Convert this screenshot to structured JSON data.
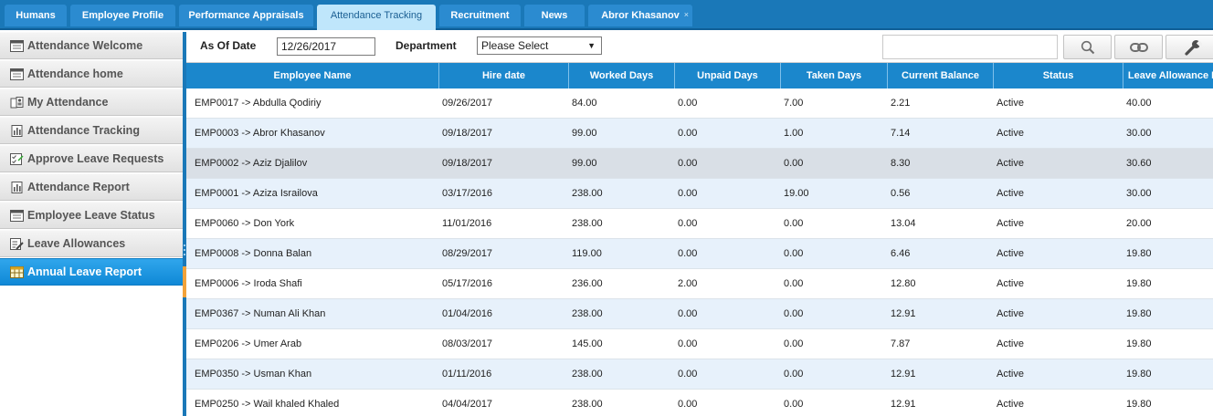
{
  "tabs": [
    {
      "label": "Humans",
      "active": false
    },
    {
      "label": "Employee Profile",
      "active": false
    },
    {
      "label": "Performance Appraisals",
      "active": false
    },
    {
      "label": "Attendance Tracking",
      "active": true
    },
    {
      "label": "Recruitment",
      "active": false
    },
    {
      "label": "News",
      "active": false
    },
    {
      "label": "Abror Khasanov",
      "active": false,
      "close_glyph": "×"
    }
  ],
  "sidebar": {
    "items": [
      {
        "label": "Attendance Welcome",
        "icon": "window-icon"
      },
      {
        "label": "Attendance home",
        "icon": "window-icon"
      },
      {
        "label": "My Attendance",
        "icon": "users-icon"
      },
      {
        "label": "Attendance Tracking",
        "icon": "report-icon"
      },
      {
        "label": "Approve Leave Requests",
        "icon": "checklist-icon"
      },
      {
        "label": "Attendance Report",
        "icon": "report-icon"
      },
      {
        "label": "Employee Leave Status",
        "icon": "window-icon"
      },
      {
        "label": "Leave Allowances",
        "icon": "edit-list-icon"
      },
      {
        "label": "Annual Leave Report",
        "icon": "calendar-grid-icon",
        "active": true
      }
    ]
  },
  "filters": {
    "as_of_date_label": "As Of Date",
    "as_of_date_value": "12/26/2017",
    "department_label": "Department",
    "department_value": "Please Select",
    "search_value": ""
  },
  "toolbar": {
    "search_icon": "magnifier-icon",
    "link_icon": "chain-link-icon",
    "settings_icon": "wrench-icon"
  },
  "grid": {
    "columns": [
      "Employee Name",
      "Hire date",
      "Worked Days",
      "Unpaid Days",
      "Taken Days",
      "Current Balance",
      "Status",
      "Leave Allowance D"
    ],
    "rows": [
      [
        "EMP0017 -> Abdulla Qodiriy",
        "09/26/2017",
        "84.00",
        "0.00",
        "7.00",
        "2.21",
        "Active",
        "40.00"
      ],
      [
        "EMP0003 -> Abror Khasanov",
        "09/18/2017",
        "99.00",
        "0.00",
        "1.00",
        "7.14",
        "Active",
        "30.00"
      ],
      [
        "EMP0002 -> Aziz Djalilov",
        "09/18/2017",
        "99.00",
        "0.00",
        "0.00",
        "8.30",
        "Active",
        "30.60"
      ],
      [
        "EMP0001 -> Aziza Israilova",
        "03/17/2016",
        "238.00",
        "0.00",
        "19.00",
        "0.56",
        "Active",
        "30.00"
      ],
      [
        "EMP0060 -> Don York",
        "11/01/2016",
        "238.00",
        "0.00",
        "0.00",
        "13.04",
        "Active",
        "20.00"
      ],
      [
        "EMP0008 -> Donna Balan",
        "08/29/2017",
        "119.00",
        "0.00",
        "0.00",
        "6.46",
        "Active",
        "19.80"
      ],
      [
        "EMP0006 -> Iroda Shafi",
        "05/17/2016",
        "236.00",
        "2.00",
        "0.00",
        "12.80",
        "Active",
        "19.80"
      ],
      [
        "EMP0367 -> Numan Ali Khan",
        "01/04/2016",
        "238.00",
        "0.00",
        "0.00",
        "12.91",
        "Active",
        "19.80"
      ],
      [
        "EMP0206 -> Umer Arab",
        "08/03/2017",
        "145.00",
        "0.00",
        "0.00",
        "7.87",
        "Active",
        "19.80"
      ],
      [
        "EMP0350 -> Usman Khan",
        "01/11/2016",
        "238.00",
        "0.00",
        "0.00",
        "12.91",
        "Active",
        "19.80"
      ],
      [
        "EMP0250 -> Wail khaled Khaled",
        "04/04/2017",
        "238.00",
        "0.00",
        "0.00",
        "12.91",
        "Active",
        "19.80"
      ]
    ],
    "highlighted_row": 2
  },
  "colors": {
    "tab_bar": "#1a78b8",
    "active_tab": "#bfe6fb",
    "grid_header": "#1b87cc",
    "row_alt": "#e7f1fb",
    "row_highlight": "#d9dfe6",
    "sidebar_active": "#1592dc"
  }
}
